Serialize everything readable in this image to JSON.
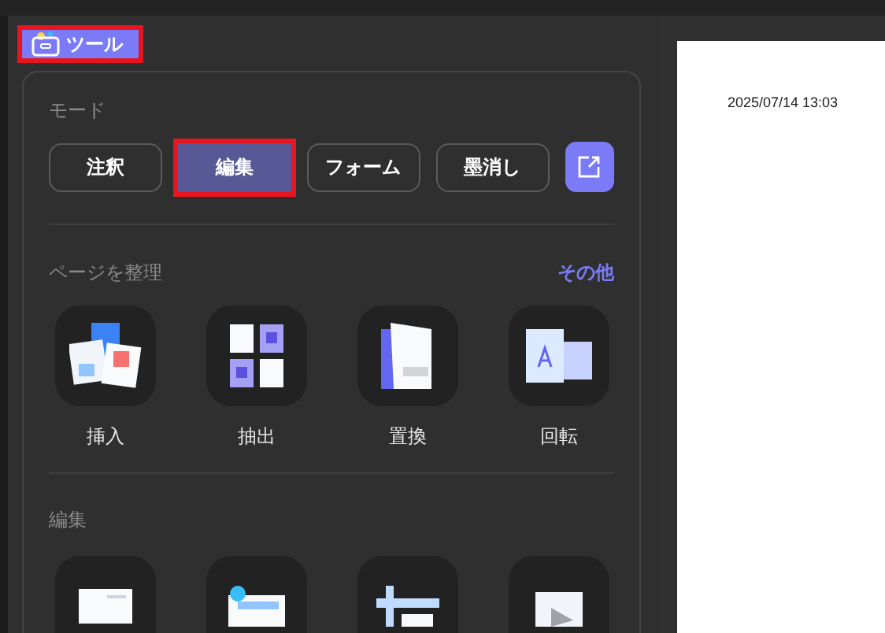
{
  "tool_button": {
    "label": "ツール",
    "highlighted": true
  },
  "mode": {
    "title": "モード",
    "options": [
      {
        "label": "注釈",
        "selected": false,
        "highlighted": false
      },
      {
        "label": "編集",
        "selected": true,
        "highlighted": true
      },
      {
        "label": "フォーム",
        "selected": false,
        "highlighted": false
      },
      {
        "label": "墨消し",
        "selected": false,
        "highlighted": false
      }
    ]
  },
  "organize": {
    "title": "ページを整理",
    "more_link": "その他",
    "items": [
      {
        "kind": "insert",
        "label": "挿入"
      },
      {
        "kind": "extract",
        "label": "抽出"
      },
      {
        "kind": "replace",
        "label": "置換"
      },
      {
        "kind": "rotate",
        "label": "回転"
      }
    ]
  },
  "edit": {
    "title": "編集",
    "items": [
      {
        "kind": "text"
      },
      {
        "kind": "comment"
      },
      {
        "kind": "crop"
      },
      {
        "kind": "image"
      }
    ]
  },
  "document": {
    "timestamp": "2025/07/14 13:03"
  }
}
